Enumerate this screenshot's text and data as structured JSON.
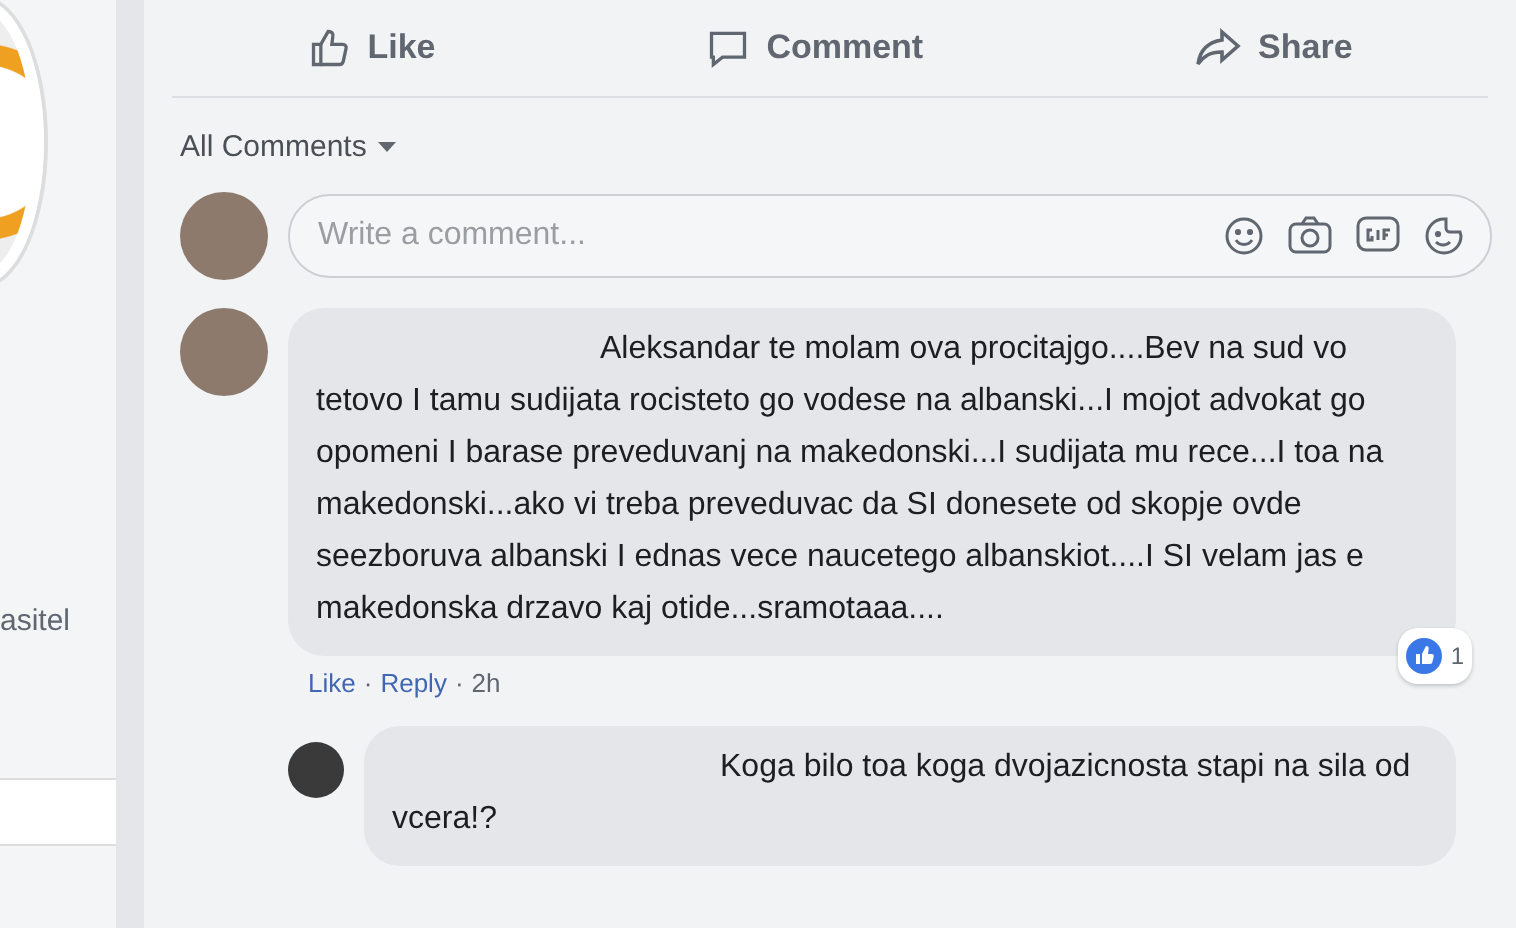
{
  "sidebar": {
    "text": "asitel"
  },
  "actions": [
    {
      "kind": "like",
      "label": "Like"
    },
    {
      "kind": "comment",
      "label": "Comment"
    },
    {
      "kind": "share",
      "label": "Share"
    }
  ],
  "comment_filter": "All Comments",
  "composer": {
    "placeholder": "Write a comment..."
  },
  "comments": [
    {
      "text": "Aleksandar te molam ova procitajgo....Bev na sud vo tetovo I tamu sudijata rocisteto go vodese na albanski...I mojot advokat go opomeni I barase preveduvanj na makedonski...I sudijata mu rece...I toa na makedonski...ako vi treba preveduvac da SI donesete od skopje ovde seezboruva albanski I ednas vece naucetego albanskiot....I SI velam jas e makedonska drzavo kaj otide...sramotaaa....",
      "links": [
        "Like",
        "Reply",
        "2h"
      ],
      "separator": "·",
      "reactions": "1",
      "replies": [
        {
          "text": "Koga bilo toa koga dvojazicnosta stapi na sila od vcera!?"
        }
      ]
    }
  ]
}
